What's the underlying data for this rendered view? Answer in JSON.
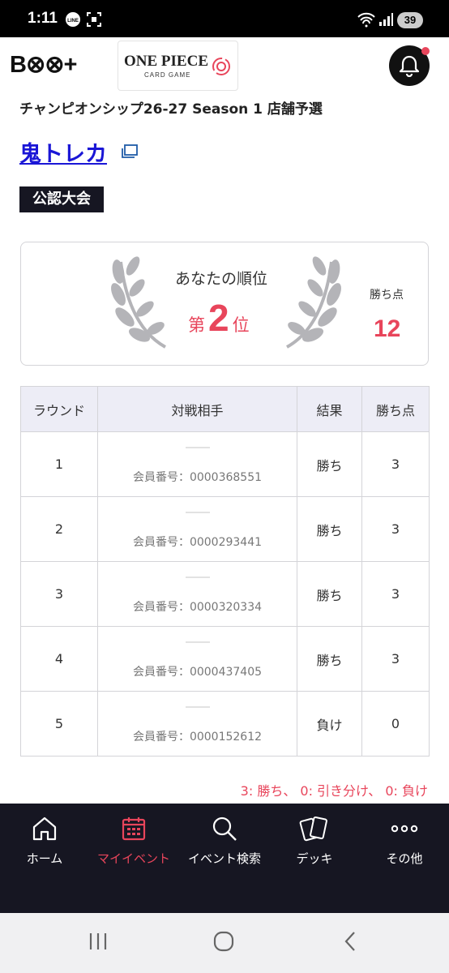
{
  "status_bar": {
    "time": "1:11",
    "battery": "39"
  },
  "header": {
    "brand": "B⊗⊗+",
    "game_logo_title": "ONE PIECE",
    "game_logo_sub": "CARD GAME"
  },
  "event": {
    "title": "チャンピオンシップ26-27 Season 1 店舗予選",
    "store_name": "鬼トレカ",
    "tag": "公認大会"
  },
  "rank": {
    "label": "あなたの順位",
    "prefix": "第",
    "value": "2",
    "suffix": "位",
    "points_label": "勝ち点",
    "points_value": "12"
  },
  "table": {
    "headers": [
      "ラウンド",
      "対戦相手",
      "結果",
      "勝ち点"
    ],
    "rows": [
      {
        "round": "1",
        "member": "会員番号：0000368551",
        "result": "勝ち",
        "points": "3"
      },
      {
        "round": "2",
        "member": "会員番号：0000293441",
        "result": "勝ち",
        "points": "3"
      },
      {
        "round": "3",
        "member": "会員番号：0000320334",
        "result": "勝ち",
        "points": "3"
      },
      {
        "round": "4",
        "member": "会員番号：0000437405",
        "result": "勝ち",
        "points": "3"
      },
      {
        "round": "5",
        "member": "会員番号：0000152612",
        "result": "負け",
        "points": "0"
      }
    ]
  },
  "summary": "3: 勝ち、 0: 引き分け、 0: 負け",
  "bottom_nav": {
    "items": [
      {
        "label": "ホーム",
        "icon": "home-icon"
      },
      {
        "label": "マイイベント",
        "icon": "calendar-icon",
        "active": true
      },
      {
        "label": "イベント検索",
        "icon": "search-icon"
      },
      {
        "label": "デッキ",
        "icon": "cards-icon"
      },
      {
        "label": "その他",
        "icon": "more-icon"
      }
    ]
  },
  "colors": {
    "accent": "#e8455b",
    "link": "#1a16d6",
    "nav_bg": "#161622",
    "header_bg": "#ededf6"
  }
}
